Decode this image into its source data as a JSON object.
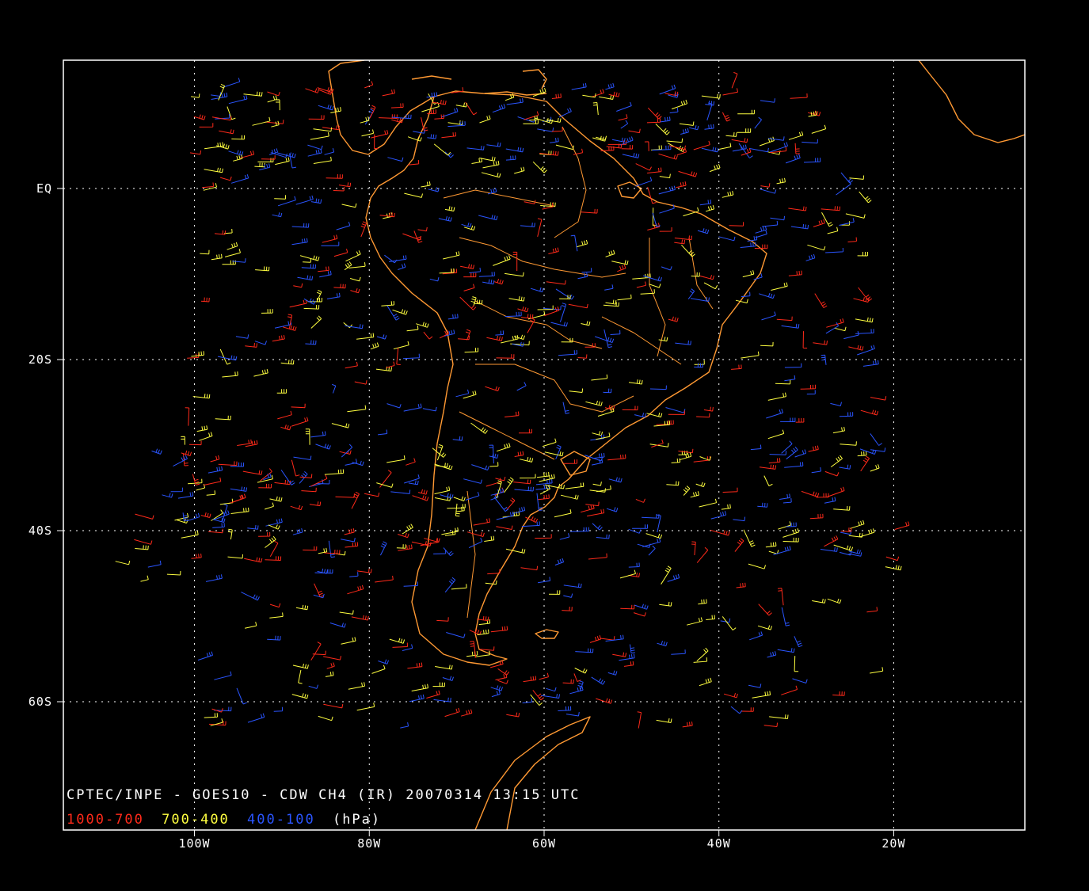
{
  "map": {
    "caption": "CPTEC/INPE - GOES10 - CDW CH4 (IR) 20070314 13:15 UTC",
    "legend": {
      "ranges": [
        {
          "label": "1000-700",
          "color": "#ff2a1a"
        },
        {
          "label": "700-400",
          "color": "#ffff40"
        },
        {
          "label": "400-100",
          "color": "#2a55ff"
        }
      ],
      "unit": "(hPa)"
    },
    "lat_labels": [
      "EQ",
      "20S",
      "40S",
      "60S"
    ],
    "lon_labels": [
      "100W",
      "80W",
      "60W",
      "40W",
      "20W"
    ],
    "extent": {
      "lon_min": -115,
      "lon_max": -5,
      "lat_min": -75,
      "lat_max": 15
    },
    "lat_gridlines": [
      0,
      -20,
      -40,
      -60
    ],
    "lon_gridlines": [
      -100,
      -80,
      -60,
      -40,
      -20
    ],
    "colors": {
      "background": "#000000",
      "frame": "#ffffff",
      "coast": "#ff9933",
      "grid": "#ffffff"
    }
  }
}
